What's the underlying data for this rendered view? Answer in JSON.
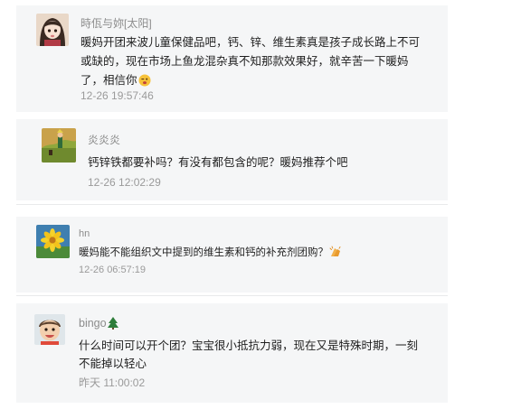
{
  "comments": [
    {
      "author": "時佤与妳[太阳]",
      "text": "暖妈开团来波儿童保健品吧，钙、锌、维生素真是孩子成长路上不可或缺的，现在市场上鱼龙混杂真不知那款效果好，就辛苦一下暖妈了，相信你",
      "emoji": "wink-face-icon",
      "time": "12-26 19:57:46"
    },
    {
      "author": "炎炎炎",
      "text": "钙锌铁都要补吗？有没有都包含的呢？暖妈推荐个吧",
      "time": "12-26 12:02:29"
    },
    {
      "author": "hn",
      "text": "暖妈能不能组织文中提到的维生素和钙的补充剂团购？",
      "emoji": "clapping-hands-icon",
      "time": "12-26 06:57:19"
    },
    {
      "author": "bingo",
      "author_emoji": "christmas-tree-icon",
      "text": "什么时间可以开个团？宝宝很小抵抗力弱，现在又是特殊时期，一刻不能掉以轻心",
      "time": "昨天 11:00:02"
    }
  ],
  "colors": {
    "card_background": "#f5f6f7",
    "author": "#8c8c8c",
    "body_text": "#1f1f1f",
    "timestamp": "#9a9a9a"
  }
}
